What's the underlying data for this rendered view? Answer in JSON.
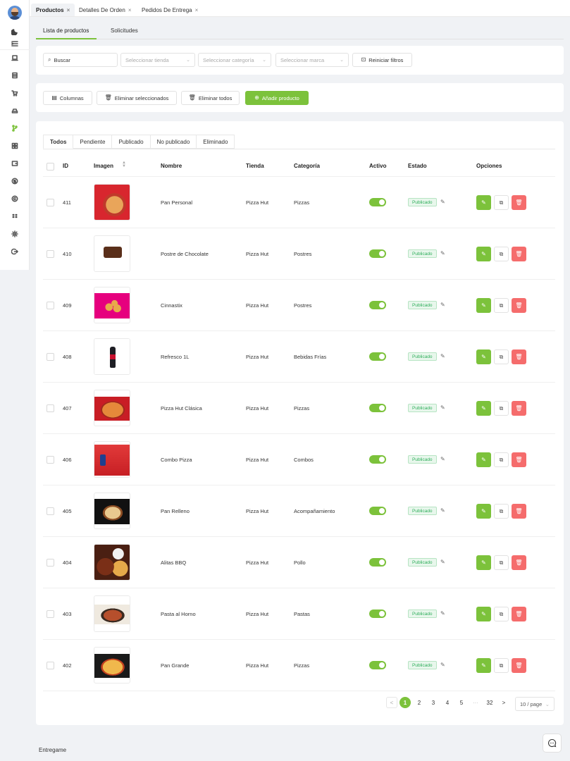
{
  "colors": {
    "accent": "#7cc23b",
    "danger": "#f56c6c",
    "status_green": "#2fae5b"
  },
  "window_tabs": [
    {
      "label": "Productos",
      "close": "×"
    },
    {
      "label": "Detalles De Orden",
      "close": "×"
    },
    {
      "label": "Pedidos De Entrega",
      "close": "×"
    }
  ],
  "sub_tabs": [
    "Lista de productos",
    "Solicitudes"
  ],
  "filters": {
    "search_placeholder": "Buscar",
    "store_placeholder": "Seleccionar tienda",
    "category_placeholder": "Seleccionar categoría",
    "brand_placeholder": "Seleccionar marca",
    "reset_label": "Reiniciar filtros"
  },
  "actions": {
    "columns_label": "Columnas",
    "delete_selected_label": "Eliminar seleccionados",
    "delete_all_label": "Eliminar todos",
    "add_product_label": "Añadir producto"
  },
  "status_tabs": [
    "Todos",
    "Pendiente",
    "Publicado",
    "No publicado",
    "Eliminado"
  ],
  "table": {
    "headers": {
      "id": "ID",
      "image": "Imagen",
      "name": "Nombre",
      "store": "Tienda",
      "category": "Categoría",
      "active": "Activo",
      "status": "Estado",
      "options": "Opciones"
    },
    "rows": [
      {
        "id": "411",
        "name": "Pan Personal",
        "store": "Pizza Hut",
        "category": "Pizzas",
        "active": true,
        "status": "Publicado",
        "img": "pizza-red"
      },
      {
        "id": "410",
        "name": "Postre de Chocolate",
        "store": "Pizza Hut",
        "category": "Postres",
        "active": true,
        "status": "Publicado",
        "img": "brownie"
      },
      {
        "id": "409",
        "name": "Cinnastix",
        "store": "Pizza Hut",
        "category": "Postres",
        "active": true,
        "status": "Publicado",
        "img": "cinnastix"
      },
      {
        "id": "408",
        "name": "Refresco 1L",
        "store": "Pizza Hut",
        "category": "Bebidas Frías",
        "active": true,
        "status": "Publicado",
        "img": "bottle"
      },
      {
        "id": "407",
        "name": "Pizza Hut Clásica",
        "store": "Pizza Hut",
        "category": "Pizzas",
        "active": true,
        "status": "Publicado",
        "img": "pizza-red2"
      },
      {
        "id": "406",
        "name": "Combo Pizza",
        "store": "Pizza Hut",
        "category": "Combos",
        "active": true,
        "status": "Publicado",
        "img": "combo"
      },
      {
        "id": "405",
        "name": "Pan Relleno",
        "store": "Pizza Hut",
        "category": "Acompañamiento",
        "active": true,
        "status": "Publicado",
        "img": "bread-dark"
      },
      {
        "id": "404",
        "name": "Alitas BBQ",
        "store": "Pizza Hut",
        "category": "Pollo",
        "active": true,
        "status": "Publicado",
        "img": "wings"
      },
      {
        "id": "403",
        "name": "Pasta al Horno",
        "store": "Pizza Hut",
        "category": "Pastas",
        "active": true,
        "status": "Publicado",
        "img": "pasta"
      },
      {
        "id": "402",
        "name": "Pan Grande",
        "store": "Pizza Hut",
        "category": "Pizzas",
        "active": true,
        "status": "Publicado",
        "img": "pizza-dark"
      }
    ]
  },
  "pagination": {
    "pages": [
      "1",
      "2",
      "3",
      "4",
      "5"
    ],
    "ellipsis": "···",
    "last": "32",
    "current": "1",
    "page_size": "10 / page"
  },
  "footer": {
    "brand": "Entregame"
  }
}
